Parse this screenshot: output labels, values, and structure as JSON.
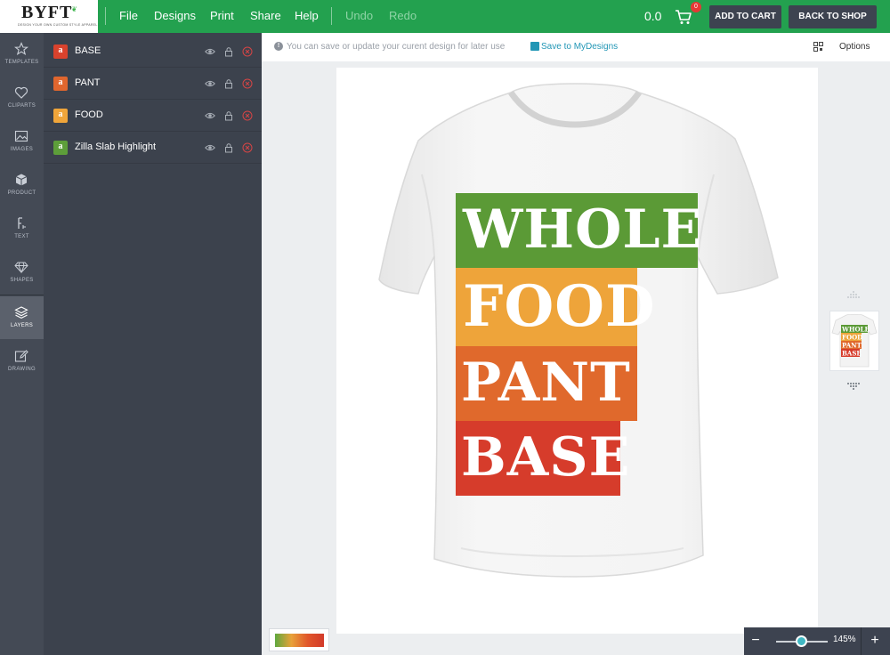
{
  "app": {
    "logo": "BYFT",
    "logo_tagline": "DESIGN YOUR OWN CUSTOM STYLE APPAREL"
  },
  "menu": {
    "items": [
      "File",
      "Designs",
      "Print",
      "Share",
      "Help"
    ],
    "undo": "Undo",
    "redo": "Redo"
  },
  "cart": {
    "price": "0.0",
    "count": "0",
    "add_to_cart": "ADD TO CART",
    "back_to_shop": "BACK TO SHOP"
  },
  "rail": {
    "items": [
      {
        "label": "TEMPLATES",
        "icon": "star-icon"
      },
      {
        "label": "CLIPARTS",
        "icon": "heart-icon"
      },
      {
        "label": "IMAGES",
        "icon": "image-icon"
      },
      {
        "label": "PRODUCT",
        "icon": "cube-icon"
      },
      {
        "label": "TEXT",
        "icon": "text-icon"
      },
      {
        "label": "SHAPES",
        "icon": "diamond-icon"
      },
      {
        "label": "LAYERS",
        "icon": "layers-icon",
        "active": true
      },
      {
        "label": "DRAWING",
        "icon": "pencil-icon"
      }
    ]
  },
  "layers": [
    {
      "name": "BASE",
      "color": "#d9422d"
    },
    {
      "name": "PANT",
      "color": "#e0662e"
    },
    {
      "name": "FOOD",
      "color": "#f0a53a"
    },
    {
      "name": "Zilla Slab Highlight",
      "color": "#5d9e3a"
    }
  ],
  "infobar": {
    "message": "You can save or update your curent design for later use",
    "save_link": "Save to MyDesigns",
    "options": "Options"
  },
  "design": {
    "words": [
      {
        "text": "WHOLE",
        "color": "#5b9a36"
      },
      {
        "text": "FOOD",
        "color": "#eea43a"
      },
      {
        "text": "PANT",
        "color": "#e0692c"
      },
      {
        "text": "BASE",
        "color": "#d63c2b"
      }
    ]
  },
  "thumbnail": {
    "words": [
      "WHOLE",
      "FOOD",
      "PANT",
      "BASE"
    ]
  },
  "zoom": {
    "minus": "−",
    "plus": "+",
    "value": "145%",
    "level_fraction": 0.5
  },
  "colors": {
    "topbar": "#23a14f",
    "rail": "#444a55",
    "panel": "#3c424d",
    "link": "#2196b5"
  }
}
